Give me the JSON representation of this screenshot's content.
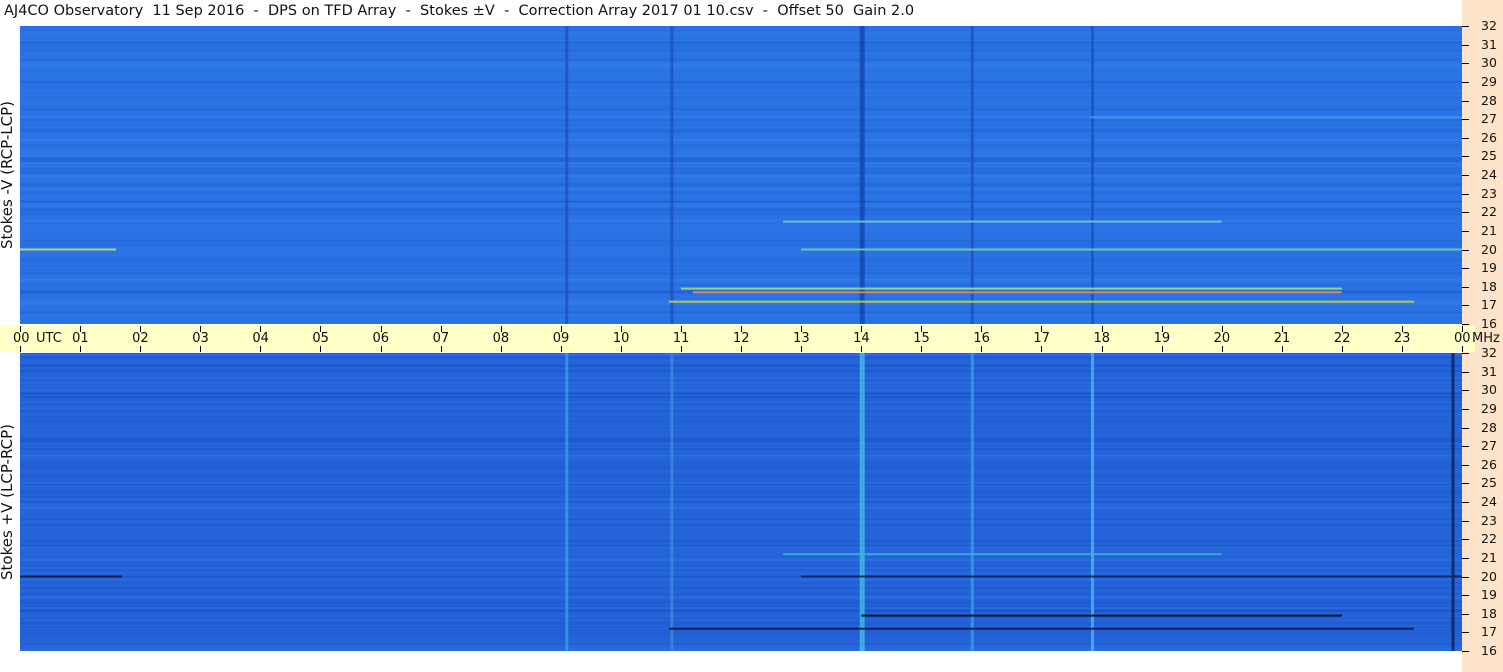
{
  "title": "AJ4CO Observatory  11 Sep 2016  -  DPS on TFD Array  -  Stokes ±V  -  Correction Array 2017 01 10.csv  -  Offset 50  Gain 2.0",
  "colors": {
    "background_top": "#2a73e4",
    "background_bottom": "#2463d8",
    "axis_band": "#ffffc8",
    "freq_band": "#fde3c9"
  },
  "chart_data": [
    {
      "type": "heatmap",
      "panel": "top",
      "ylabel": "Stokes -V (RCP-LCP)",
      "xlabel": "UTC",
      "x_ticks": [
        "00",
        "01",
        "02",
        "03",
        "04",
        "05",
        "06",
        "07",
        "08",
        "09",
        "10",
        "11",
        "12",
        "13",
        "14",
        "15",
        "16",
        "17",
        "18",
        "19",
        "20",
        "21",
        "22",
        "23",
        "00"
      ],
      "y_unit": "MHz",
      "y_ticks": [
        16,
        17,
        18,
        19,
        20,
        21,
        22,
        23,
        24,
        25,
        26,
        27,
        28,
        29,
        30,
        31,
        32
      ],
      "xlim_hours": [
        0,
        24
      ],
      "ylim_mhz": [
        16,
        32
      ],
      "features": [
        {
          "kind": "vertical_line",
          "t": 9.1,
          "color": "#1e4fb8"
        },
        {
          "kind": "vertical_line",
          "t": 10.85,
          "color": "#1e4fb8"
        },
        {
          "kind": "vertical_line",
          "t": 14.0,
          "color": "#1440a8"
        },
        {
          "kind": "vertical_line",
          "t": 15.85,
          "color": "#1e4fb8"
        },
        {
          "kind": "vertical_line",
          "t": 17.85,
          "color": "#1e4fb8"
        },
        {
          "kind": "hband",
          "mhz": 17.2,
          "t0": 10.8,
          "t1": 23.2,
          "color": "#c8d030"
        },
        {
          "kind": "hband",
          "mhz": 17.7,
          "t0": 11.2,
          "t1": 22.0,
          "color": "#e89050"
        },
        {
          "kind": "hband",
          "mhz": 17.9,
          "t0": 11.0,
          "t1": 22.0,
          "color": "#a0e070"
        },
        {
          "kind": "hband",
          "mhz": 20.0,
          "t0": 0.0,
          "t1": 1.6,
          "color": "#c8e050"
        },
        {
          "kind": "hband",
          "mhz": 20.0,
          "t0": 13.0,
          "t1": 24.0,
          "color": "#6fd0a0"
        },
        {
          "kind": "hband",
          "mhz": 21.5,
          "t0": 12.7,
          "t1": 20.0,
          "color": "#70c8e0"
        },
        {
          "kind": "hband",
          "mhz": 27.1,
          "t0": 17.8,
          "t1": 24.0,
          "color": "#3b9ae8"
        }
      ]
    },
    {
      "type": "heatmap",
      "panel": "bottom",
      "ylabel": "Stokes +V (LCP-RCP)",
      "xlabel": "UTC",
      "y_unit": "MHz",
      "y_ticks": [
        16,
        17,
        18,
        19,
        20,
        21,
        22,
        23,
        24,
        25,
        26,
        27,
        28,
        29,
        30,
        31,
        32
      ],
      "xlim_hours": [
        0,
        24
      ],
      "ylim_mhz": [
        16,
        32
      ],
      "features": [
        {
          "kind": "vertical_line",
          "t": 9.1,
          "color": "#3aa0e8"
        },
        {
          "kind": "vertical_line",
          "t": 10.85,
          "color": "#3a8ee0"
        },
        {
          "kind": "vertical_line",
          "t": 14.0,
          "color": "#48c0e8"
        },
        {
          "kind": "vertical_line",
          "t": 15.85,
          "color": "#3aa0e8"
        },
        {
          "kind": "vertical_line",
          "t": 17.85,
          "color": "#48c0e8"
        },
        {
          "kind": "vertical_line",
          "t": 23.85,
          "color": "#0a1a50"
        },
        {
          "kind": "hband",
          "mhz": 17.2,
          "t0": 10.8,
          "t1": 23.2,
          "color": "#0a1a50"
        },
        {
          "kind": "hband",
          "mhz": 17.9,
          "t0": 14.0,
          "t1": 22.0,
          "color": "#000814"
        },
        {
          "kind": "hband",
          "mhz": 20.0,
          "t0": 0.0,
          "t1": 1.7,
          "color": "#081840"
        },
        {
          "kind": "hband",
          "mhz": 20.0,
          "t0": 13.0,
          "t1": 24.0,
          "color": "#0c2460"
        },
        {
          "kind": "hband",
          "mhz": 21.2,
          "t0": 12.7,
          "t1": 20.0,
          "color": "#3ab0e0"
        }
      ]
    }
  ]
}
